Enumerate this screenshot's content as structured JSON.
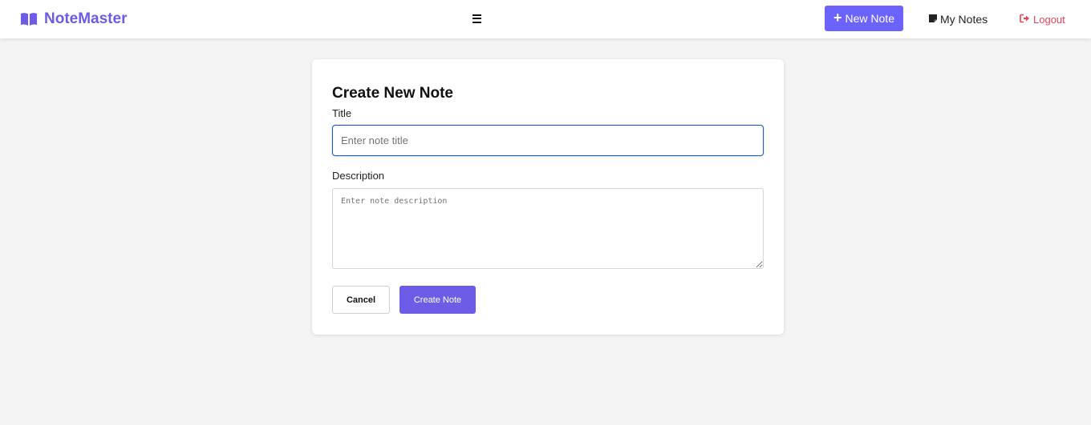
{
  "header": {
    "brand": "NoteMaster",
    "new_note_label": "New Note",
    "my_notes_label": "My Notes",
    "logout_label": "Logout"
  },
  "form": {
    "heading": "Create New Note",
    "title_label": "Title",
    "title_placeholder": "Enter note title",
    "title_value": "",
    "description_label": "Description",
    "description_placeholder": "Enter note description",
    "description_value": "",
    "cancel_label": "Cancel",
    "create_label": "Create Note"
  },
  "icons": {
    "brand": "book-open-icon",
    "menu": "hamburger-menu-icon",
    "new_note": "plus-icon",
    "my_notes": "sticky-note-icon",
    "logout": "sign-out-icon"
  },
  "colors": {
    "brand": "#6c5ce7",
    "primary": "#6c63ff",
    "logout": "#e8445a",
    "background": "#f4f4f4",
    "focus_border": "#1d5fbf"
  }
}
